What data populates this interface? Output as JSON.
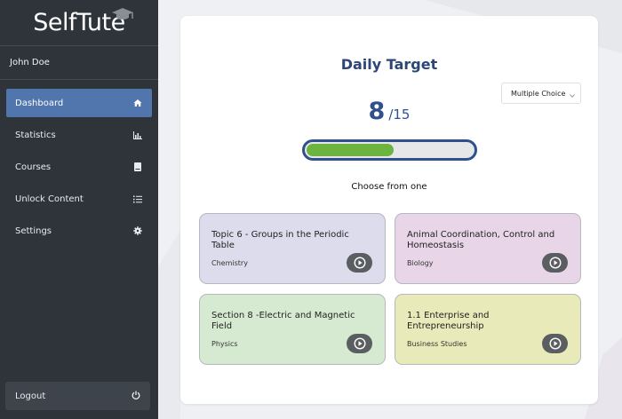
{
  "brand": {
    "logo_text": "SelfTute"
  },
  "user": {
    "name": "John Doe"
  },
  "sidebar": {
    "items": [
      {
        "label": "Dashboard",
        "icon": "home-icon",
        "active": true
      },
      {
        "label": "Statistics",
        "icon": "bar-chart-icon",
        "active": false
      },
      {
        "label": "Courses",
        "icon": "book-icon",
        "active": false
      },
      {
        "label": "Unlock Content",
        "icon": "list-icon",
        "active": false
      },
      {
        "label": "Settings",
        "icon": "gear-icon",
        "active": false
      }
    ],
    "logout": {
      "label": "Logout",
      "icon": "power-icon"
    }
  },
  "main": {
    "title": "Daily Target",
    "mode_select": {
      "value": "Multiple Choice"
    },
    "score": {
      "current": "8",
      "total": "/15"
    },
    "progress": {
      "value": 8,
      "max": 15
    },
    "choose_label": "Choose from one",
    "cards": [
      {
        "title": "Topic 6 - Groups in the Periodic Table",
        "subject": "Chemistry",
        "color": "#dcdcec"
      },
      {
        "title": "Animal Coordination, Control and Homeostasis",
        "subject": "Biology",
        "color": "#e8d6e8"
      },
      {
        "title": "Section 8 -Electric and Magnetic Field",
        "subject": "Physics",
        "color": "#d6ead2"
      },
      {
        "title": "1.1 Enterprise and Entrepreneurship",
        "subject": "Business Studies",
        "color": "#e9eab9"
      }
    ]
  },
  "colors": {
    "sidebar_bg": "#2f343b",
    "active_nav": "#5076ad",
    "accent_navy": "#2f4f8d",
    "progress_green": "#6cb33f"
  }
}
